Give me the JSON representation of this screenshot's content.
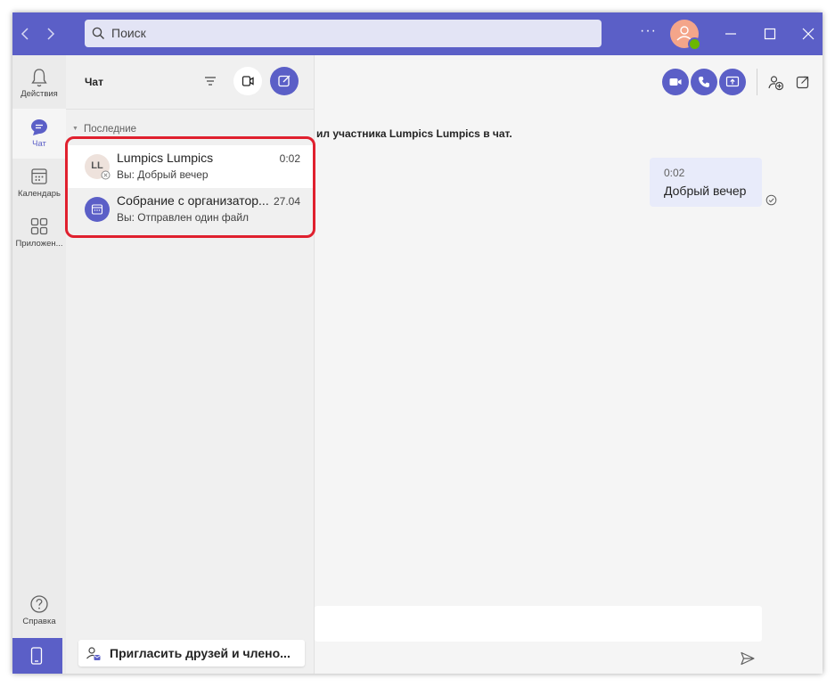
{
  "search": {
    "placeholder": "Поиск"
  },
  "titlebar": {
    "more_label": "···"
  },
  "rail": {
    "items": [
      {
        "label": "Действия",
        "icon": "bell-icon"
      },
      {
        "label": "Чат",
        "icon": "chat-icon"
      },
      {
        "label": "Календарь",
        "icon": "calendar-icon"
      },
      {
        "label": "Приложен...",
        "icon": "apps-icon"
      },
      {
        "label": "Справка",
        "icon": "help-icon"
      }
    ]
  },
  "chatlist": {
    "title": "Чат",
    "section": "Последние",
    "items": [
      {
        "initials": "LL",
        "name": "Lumpics Lumpics",
        "preview": "Вы: Добрый вечер",
        "time": "0:02"
      },
      {
        "name": "Собрание с организатор...",
        "preview": "Вы: Отправлен один файл",
        "time": "27.04"
      }
    ],
    "invite": "Пригласить друзей и члено..."
  },
  "conversation": {
    "system_message": "ил участника Lumpics Lumpics в чат.",
    "message": {
      "time": "0:02",
      "text": "Добрый вечер"
    }
  },
  "colors": {
    "accent": "#5b5fc7",
    "highlight": "#e0202e",
    "presence": "#6bb700"
  }
}
